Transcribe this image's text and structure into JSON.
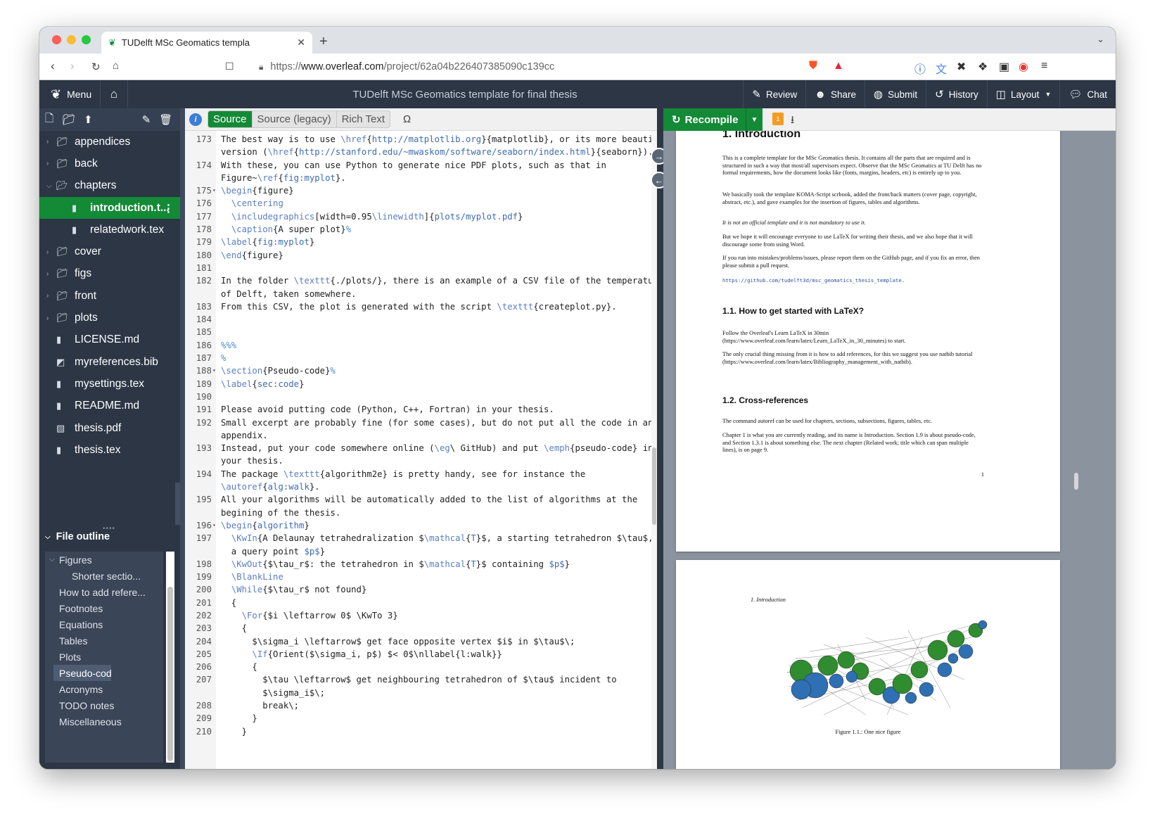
{
  "browser": {
    "tab_title": "TUDelft MSc Geomatics templa",
    "url_prefix": "https://",
    "url_host": "www.overleaf.com",
    "url_path": "/project/62a04b226407385090c139cc"
  },
  "header": {
    "menu_label": "Menu",
    "project_title": "TUDelft MSc Geomatics template for final thesis",
    "buttons": [
      "Review",
      "Share",
      "Submit",
      "History",
      "Layout",
      "Chat"
    ]
  },
  "editor_toolbar": {
    "modes": [
      "Source",
      "Source (legacy)",
      "Rich Text"
    ],
    "omega": "Ω"
  },
  "pdf_toolbar": {
    "recompile_label": "Recompile",
    "log_badge": "1"
  },
  "file_tree": [
    {
      "label": "appendices",
      "type": "folder",
      "open": false
    },
    {
      "label": "back",
      "type": "folder",
      "open": false
    },
    {
      "label": "chapters",
      "type": "folder",
      "open": true
    },
    {
      "label": "introduction.t...",
      "type": "file",
      "selected": true,
      "indent": 1
    },
    {
      "label": "relatedwork.tex",
      "type": "file",
      "indent": 1
    },
    {
      "label": "cover",
      "type": "folder",
      "open": false
    },
    {
      "label": "figs",
      "type": "folder",
      "open": false
    },
    {
      "label": "front",
      "type": "folder",
      "open": false
    },
    {
      "label": "plots",
      "type": "folder",
      "open": false
    },
    {
      "label": "LICENSE.md",
      "type": "file"
    },
    {
      "label": "myreferences.bib",
      "type": "bib"
    },
    {
      "label": "mysettings.tex",
      "type": "file"
    },
    {
      "label": "README.md",
      "type": "file"
    },
    {
      "label": "thesis.pdf",
      "type": "image"
    },
    {
      "label": "thesis.tex",
      "type": "file"
    }
  ],
  "outline": {
    "title": "File outline",
    "items": [
      {
        "label": "Figures",
        "level": 0,
        "chev": true
      },
      {
        "label": "Shorter sectio...",
        "level": 1
      },
      {
        "label": "How to add refere...",
        "level": 0
      },
      {
        "label": "Footnotes",
        "level": 0
      },
      {
        "label": "Equations",
        "level": 0
      },
      {
        "label": "Tables",
        "level": 0
      },
      {
        "label": "Plots",
        "level": 0
      },
      {
        "label": "Pseudo-code",
        "level": 0,
        "selected": true
      },
      {
        "label": "Acronyms",
        "level": 0
      },
      {
        "label": "TODO notes",
        "level": 0
      },
      {
        "label": "Miscellaneous",
        "level": 0
      }
    ]
  },
  "code_lines": [
    {
      "n": "173",
      "t": "The best way is to use <c>\\href</c>{<a>http://matplotlib.org</a>}{matplotlib}, or its more beautiful"
    },
    {
      "n": "",
      "t": "version (<c>\\href</c>{<a>http://stanford.edu/~mwaskom/software/seaborn/index.html</a>}{seaborn})."
    },
    {
      "n": "174",
      "t": "With these, you can use Python to generate nice PDF plots, such as that in"
    },
    {
      "n": "",
      "t": "Figure~<c>\\ref</c>{<a>fig:myplot</a>}."
    },
    {
      "n": "175",
      "f": true,
      "t": "<c>\\begin</c>{figure}"
    },
    {
      "n": "176",
      "t": "  <c>\\centering</c>"
    },
    {
      "n": "177",
      "t": "  <c>\\includegraphics</c>[width=0.95<c>\\linewidth</c>]{<a>plots/myplot.pdf</a>}"
    },
    {
      "n": "178",
      "t": "  <c>\\caption</c>{A super plot}<m>%</m>"
    },
    {
      "n": "179",
      "t": "<c>\\label</c>{<a>fig:myplot</a>}"
    },
    {
      "n": "180",
      "t": "<c>\\end</c>{figure}"
    },
    {
      "n": "181",
      "t": ""
    },
    {
      "n": "182",
      "t": "In the folder <c>\\texttt</c>{./plots/}, there is an example of a CSV file of the temperature"
    },
    {
      "n": "",
      "t": "of Delft, taken somewhere."
    },
    {
      "n": "183",
      "t": "From this CSV, the plot is generated with the script <c>\\texttt</c>{createplot.py}."
    },
    {
      "n": "184",
      "t": ""
    },
    {
      "n": "185",
      "t": ""
    },
    {
      "n": "186",
      "t": "<m>%%%</m>"
    },
    {
      "n": "187",
      "t": "<m>%</m>"
    },
    {
      "n": "188",
      "f": true,
      "t": "<c>\\section</c>{Pseudo-code}<m>%</m>"
    },
    {
      "n": "189",
      "t": "<c>\\label</c>{<a>sec:code</a>}"
    },
    {
      "n": "190",
      "t": ""
    },
    {
      "n": "191",
      "t": "Please avoid putting code (Python, C++, Fortran) in your thesis."
    },
    {
      "n": "192",
      "t": "Small excerpt are probably fine (for some cases), but do not put all the code in an"
    },
    {
      "n": "",
      "t": "appendix."
    },
    {
      "n": "193",
      "t": "Instead, put your code somewhere online (<c>\\eg</c>\\ GitHub) and put <c>\\emph</c>{pseudo-code} in"
    },
    {
      "n": "",
      "t": "your thesis."
    },
    {
      "n": "194",
      "t": "The package <c>\\texttt</c>{algorithm2e} is pretty handy, see for instance the"
    },
    {
      "n": "",
      "t": "<c>\\autoref</c>{<a>alg:walk</a>}."
    },
    {
      "n": "195",
      "t": "All your algorithms will be automatically added to the list of algorithms at the"
    },
    {
      "n": "",
      "t": "begining of the thesis."
    },
    {
      "n": "196",
      "f": true,
      "t": "<c>\\begin</c>{<a>algorithm</a>}"
    },
    {
      "n": "197",
      "t": "  <c>\\KwIn</c>{A Delaunay tetrahedralization $<c>\\mathcal</c>{<a>T</a>}$, a starting tetrahedron $\\tau$, and"
    },
    {
      "n": "",
      "t": "  a query point <a>$p$</a>}"
    },
    {
      "n": "198",
      "t": "  <c>\\KwOut</c>{$\\tau_r$: the tetrahedron in $<c>\\mathcal</c>{<a>T</a>}$ containing <a>$p$</a>}"
    },
    {
      "n": "199",
      "t": "  <c>\\BlankLine</c>"
    },
    {
      "n": "200",
      "t": "  <c>\\While</c>{$\\tau_r$ not found}"
    },
    {
      "n": "201",
      "t": "  {"
    },
    {
      "n": "202",
      "t": "    <c>\\For</c>{$i \\leftarrow 0$ \\KwTo 3}"
    },
    {
      "n": "203",
      "t": "    {"
    },
    {
      "n": "204",
      "t": "      $\\sigma_i \\leftarrow$ get face opposite vertex $i$ in $\\tau$\\;"
    },
    {
      "n": "205",
      "t": "      <c>\\If</c>{Orient($\\sigma_i, p$) $< 0$\\nllabel{l:walk}}"
    },
    {
      "n": "206",
      "t": "      {"
    },
    {
      "n": "207",
      "t": "        $\\tau \\leftarrow$ get neighbouring tetrahedron of $\\tau$ incident to"
    },
    {
      "n": "",
      "t": "        $\\sigma_i$\\;"
    },
    {
      "n": "208",
      "t": "        break\\;"
    },
    {
      "n": "209",
      "t": "      }"
    },
    {
      "n": "210",
      "t": "    }"
    }
  ],
  "pdf": {
    "chapter_heading": "1.  Introduction",
    "p1": "This is a complete template for the MSc Geomatics thesis. It contains all the parts that are required and is structured in such a way that most/all supervisors expect. Observe that the MSc Geomatics at TU Delft has no formal requirements, how the document looks like (fonts, margins, headers, etc) is entirely up to you.",
    "p2": "We basically took the template KOMA-Script scrbook, added the front/back matters (cover page, copyright, abstract, etc.), and gave examples for the insertion of figures, tables and algorithms.",
    "p3": "It is not an official template and it is not mandatory to use it.",
    "p4": "But we hope it will encourage everyone to use LaTeX for writing their thesis, and we also hope that it will discourage some from using Word.",
    "p5": "If you run into mistakes/problems/issues, please report them on the GitHub page, and if you fix an error, then please submit a pull request.",
    "p6": "https://github.com/tudelft3d/msc_geomatics_thesis_template.",
    "s1": "1.1.  How to get started with LaTeX?",
    "p7": "Follow the Overleaf's Learn LaTeX in 30min (https://www.overleaf.com/learn/latex/Learn_LaTeX_in_30_minutes) to start.",
    "p8": "The only crucial thing missing from it is how to add references, for this we suggest you use natbib tutorial (https://www.overleaf.com/learn/latex/Bibliography_management_with_natbib).",
    "s2": "1.2.  Cross-references",
    "p9": "The command autoref can be used for chapters, sections, subsections, figures, tables, etc.",
    "p10": "Chapter 1 is what you are currently reading, and its name is Introduction. Section 1.9 is about pseudo-code, and Section 1.3.1 is about something else. The next chapter (Related work; title which can span multiple lines), is on page 9.",
    "page_number": "1",
    "page2_header": "1.  Introduction",
    "figure_caption": "Figure 1.1.: One nice figure"
  }
}
